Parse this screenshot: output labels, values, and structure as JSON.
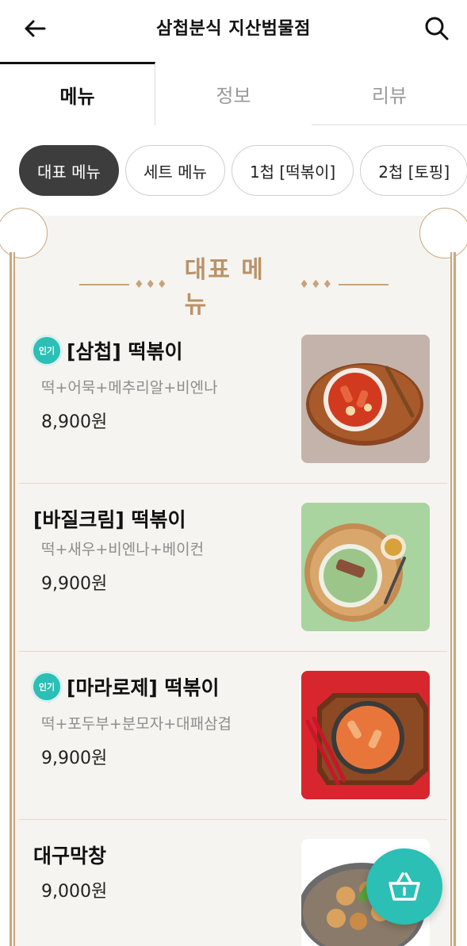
{
  "header": {
    "title": "삼첩분식 지산범물점",
    "back_icon": "arrow-left-icon",
    "search_icon": "search-icon"
  },
  "tabs": [
    {
      "label": "메뉴",
      "active": true
    },
    {
      "label": "정보",
      "active": false
    },
    {
      "label": "리뷰",
      "active": false
    }
  ],
  "chips": [
    {
      "label": "대표 메뉴",
      "active": true
    },
    {
      "label": "세트 메뉴",
      "active": false
    },
    {
      "label": "1첩 [떡볶이]",
      "active": false
    },
    {
      "label": "2첩 [토핑]",
      "active": false
    }
  ],
  "section": {
    "title": "대표 메뉴",
    "decoration": "♦♦♦"
  },
  "items": [
    {
      "name": "[삼첩] 떡볶이",
      "desc": "떡+어묵+메추리알+비엔나",
      "price": "8,900원",
      "popular": true,
      "badge": "인기"
    },
    {
      "name": "[바질크림] 떡볶이",
      "desc": "떡+새우+비엔나+베이컨",
      "price": "9,900원",
      "popular": false,
      "badge": ""
    },
    {
      "name": "[마라로제] 떡볶이",
      "desc": "떡+포두부+분모자+대패삼겹",
      "price": "9,900원",
      "popular": true,
      "badge": "인기"
    },
    {
      "name": "대구막창",
      "desc": "",
      "price": "9,000원",
      "popular": false,
      "badge": ""
    }
  ],
  "cart": {
    "icon": "basket-icon"
  },
  "colors": {
    "accent": "#2bbfb5",
    "gold": "#b9936a",
    "chip_active": "#3d3d3d"
  }
}
